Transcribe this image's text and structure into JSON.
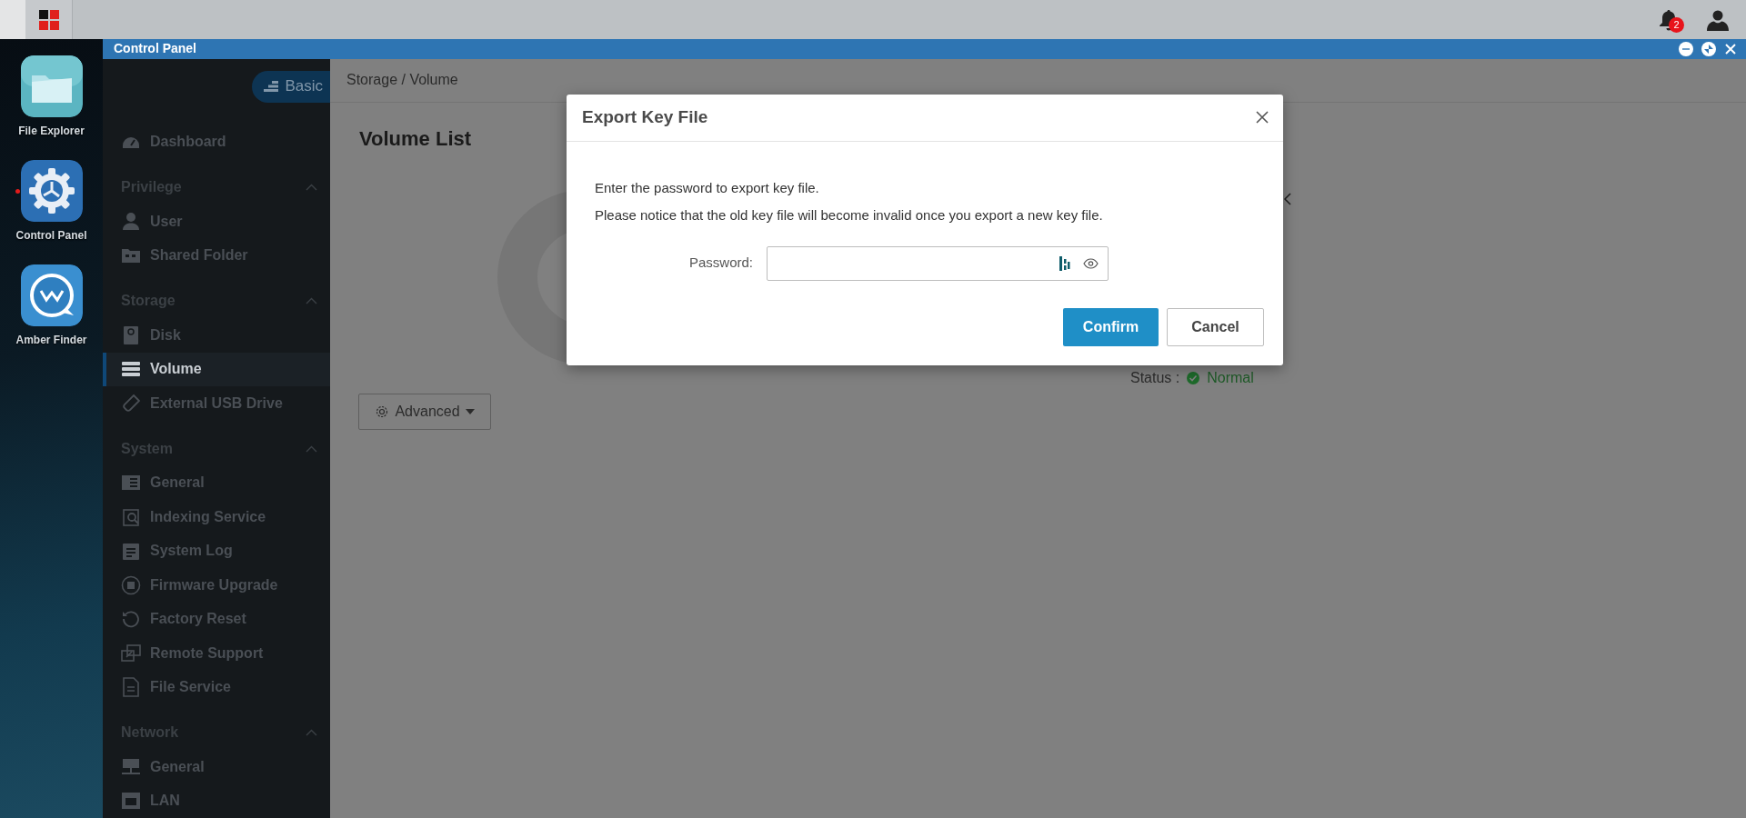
{
  "top_bar": {
    "notification_count": "2"
  },
  "dock": [
    {
      "label": "File Explorer",
      "running": false
    },
    {
      "label": "Control Panel",
      "running": true
    },
    {
      "label": "Amber Finder",
      "running": false
    }
  ],
  "window": {
    "title": "Control Panel"
  },
  "sidebar": {
    "mode_button": "Basic",
    "items": [
      {
        "kind": "link",
        "label": "Dashboard",
        "selected": false
      },
      {
        "kind": "section",
        "label": "Privilege",
        "expanded": true,
        "children": [
          {
            "label": "User",
            "selected": false
          },
          {
            "label": "Shared Folder",
            "selected": false
          }
        ]
      },
      {
        "kind": "section",
        "label": "Storage",
        "expanded": true,
        "children": [
          {
            "label": "Disk",
            "selected": false
          },
          {
            "label": "Volume",
            "selected": true
          },
          {
            "label": "External USB Drive",
            "selected": false
          }
        ]
      },
      {
        "kind": "section",
        "label": "System",
        "expanded": true,
        "children": [
          {
            "label": "General",
            "selected": false
          },
          {
            "label": "Indexing Service",
            "selected": false
          },
          {
            "label": "System Log",
            "selected": false
          },
          {
            "label": "Firmware Upgrade",
            "selected": false
          },
          {
            "label": "Factory Reset",
            "selected": false
          },
          {
            "label": "Remote Support",
            "selected": false
          },
          {
            "label": "File Service",
            "selected": false
          }
        ]
      },
      {
        "kind": "section",
        "label": "Network",
        "expanded": true,
        "children": [
          {
            "label": "General",
            "selected": false
          },
          {
            "label": "LAN",
            "selected": false
          }
        ]
      }
    ]
  },
  "content": {
    "breadcrumb": "Storage / Volume",
    "heading": "Volume List",
    "advanced_button": "Advanced",
    "status_label": "Status :",
    "status_value": "Normal"
  },
  "dialog": {
    "title": "Export Key File",
    "message_lines": [
      "Enter the password to export key file.",
      "Please notice that the old key file will become invalid once you export a new key file."
    ],
    "password_label": "Password:",
    "buttons": [
      {
        "kind": "primary",
        "label": "Confirm"
      },
      {
        "kind": "secondary",
        "label": "Cancel"
      }
    ]
  }
}
